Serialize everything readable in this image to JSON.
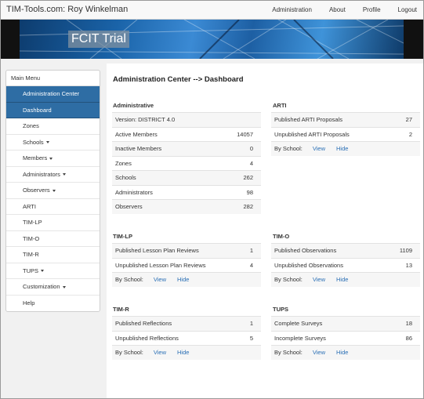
{
  "header": {
    "brand": "TIM-Tools.com: Roy Winkelman",
    "nav": [
      "Administration",
      "About",
      "Profile",
      "Logout"
    ]
  },
  "banner": {
    "title": "FCIT Trial"
  },
  "sidebar": {
    "heading": "Main Menu",
    "items": [
      {
        "label": "Administration Center",
        "active": true,
        "dropdown": false
      },
      {
        "label": "Dashboard",
        "active": true,
        "dropdown": false
      },
      {
        "label": "Zones",
        "active": false,
        "dropdown": false
      },
      {
        "label": "Schools",
        "active": false,
        "dropdown": true
      },
      {
        "label": "Members",
        "active": false,
        "dropdown": true
      },
      {
        "label": "Administrators",
        "active": false,
        "dropdown": true
      },
      {
        "label": "Observers",
        "active": false,
        "dropdown": true
      },
      {
        "label": "ARTI",
        "active": false,
        "dropdown": false
      },
      {
        "label": "TIM-LP",
        "active": false,
        "dropdown": false
      },
      {
        "label": "TIM-O",
        "active": false,
        "dropdown": false
      },
      {
        "label": "TIM-R",
        "active": false,
        "dropdown": false
      },
      {
        "label": "TUPS",
        "active": false,
        "dropdown": true
      },
      {
        "label": "Customization",
        "active": false,
        "dropdown": true
      },
      {
        "label": "Help",
        "active": false,
        "dropdown": false
      }
    ]
  },
  "main": {
    "title": "Administration Center --> Dashboard",
    "administrative": {
      "title": "Administrative",
      "rows": [
        {
          "label": "Version: DISTRICT 4.0",
          "value": ""
        },
        {
          "label": "Active Members",
          "value": "14057"
        },
        {
          "label": "Inactive Members",
          "value": "0"
        },
        {
          "label": "Zones",
          "value": "4"
        },
        {
          "label": "Schools",
          "value": "262"
        },
        {
          "label": "Administrators",
          "value": "98"
        },
        {
          "label": "Observers",
          "value": "282"
        }
      ]
    },
    "arti": {
      "title": "ARTI",
      "rows": [
        {
          "label": "Published ARTI Proposals",
          "value": "27"
        },
        {
          "label": "Unpublished ARTI Proposals",
          "value": "2"
        }
      ]
    },
    "timlp": {
      "title": "TIM-LP",
      "rows": [
        {
          "label": "Published Lesson Plan Reviews",
          "value": "1"
        },
        {
          "label": "Unpublished Lesson Plan Reviews",
          "value": "4"
        }
      ]
    },
    "timo": {
      "title": "TIM-O",
      "rows": [
        {
          "label": "Published Observations",
          "value": "1109"
        },
        {
          "label": "Unpublished Observations",
          "value": "13"
        }
      ]
    },
    "timr": {
      "title": "TIM-R",
      "rows": [
        {
          "label": "Published Reflections",
          "value": "1"
        },
        {
          "label": "Unpublished Reflections",
          "value": "5"
        }
      ]
    },
    "tups": {
      "title": "TUPS",
      "rows": [
        {
          "label": "Complete Surveys",
          "value": "18"
        },
        {
          "label": "Incomplete Surveys",
          "value": "86"
        }
      ]
    },
    "by_school": {
      "label": "By School:",
      "view": "View",
      "hide": "Hide"
    }
  }
}
